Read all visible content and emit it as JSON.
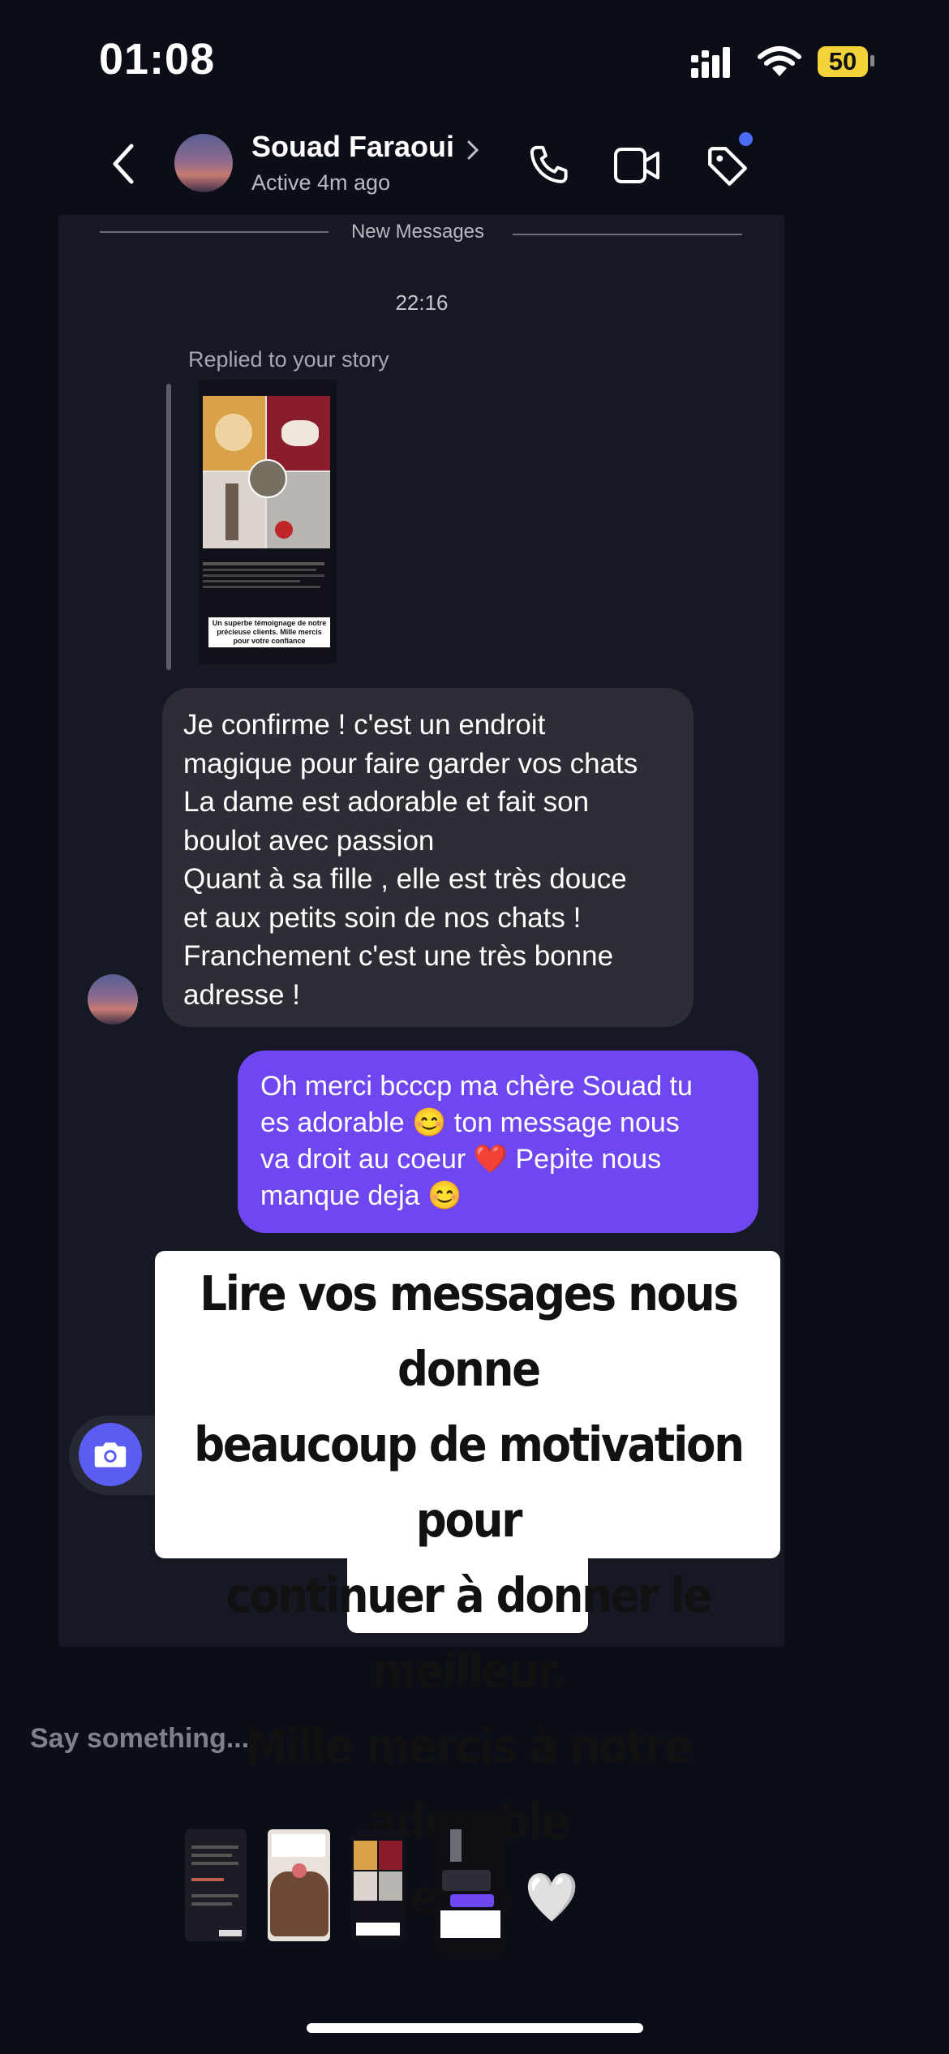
{
  "status_bar": {
    "time": "01:08",
    "battery": "50"
  },
  "header": {
    "contact_name": "Souad Faraoui",
    "status": "Active 4m ago"
  },
  "chat": {
    "new_messages_label": "New Messages",
    "timestamp": "22:16",
    "reply_context": "Replied to your story",
    "story_caption": [
      "Un superbe témoignage de notre",
      "précieuse clients. Mille mercis",
      "pour votre confiance"
    ],
    "incoming_message_lines": [
      "Je confirme ! c'est un endroit",
      "magique pour faire garder vos chats",
      "La dame est adorable et fait son",
      "boulot avec passion",
      "Quant à  sa fille , elle est très douce",
      "et aux petits soin de nos chats !",
      "Franchement c'est une très bonne",
      "adresse !"
    ],
    "outgoing_message_lines": [
      "Oh merci bcccp ma chère Souad tu",
      "es adorable 😊 ton message nous",
      "va droit au coeur ❤️ Pepite nous",
      "manque deja 😊"
    ]
  },
  "sticker": {
    "lines": [
      "Lire vos messages nous donne",
      "beaucoup de motivation pour",
      "continuer à donner le meilleur.",
      "Mille mercis à notre adorable",
      "cliente 🤍"
    ]
  },
  "composer": {
    "placeholder": "Say something..."
  },
  "icons": {
    "back": "chevron-left-icon",
    "call": "phone-icon",
    "video": "video-camera-icon",
    "tag": "tag-icon",
    "camera": "camera-icon"
  },
  "colors": {
    "background": "#0b0d17",
    "outgoing_bubble": "#6f47f0",
    "incoming_bubble": "#2c2d35",
    "camera_button": "#5b5cf2",
    "notification_dot": "#4a6cf7",
    "battery": "#f4d33a"
  }
}
